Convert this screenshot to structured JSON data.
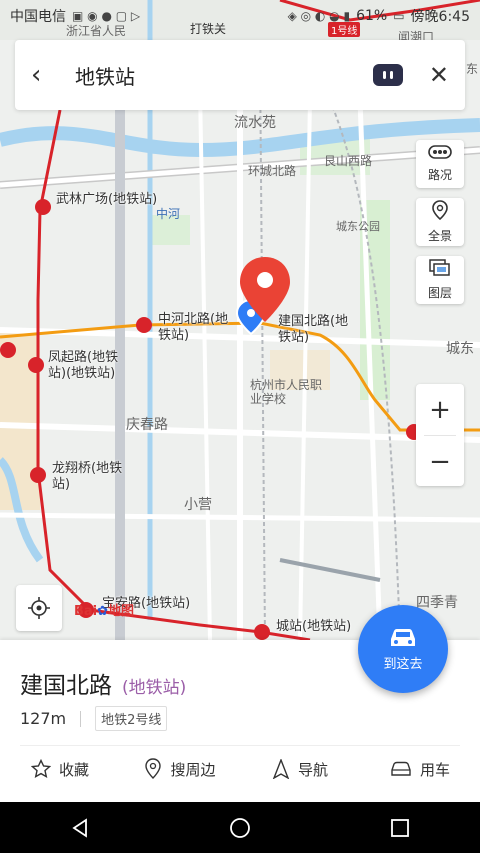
{
  "status_bar": {
    "carrier": "中国电信",
    "battery": "61%",
    "time": "傍晚6:45"
  },
  "search": {
    "query": "地铁站"
  },
  "side_buttons": {
    "traffic": "路况",
    "panorama": "全景",
    "layers": "图层"
  },
  "zoom": {
    "plus": "+",
    "minus": "−"
  },
  "map_labels": {
    "stations": [
      "武林广场(地铁站)",
      "中河北路(地铁站)",
      "建国北路(地铁站)",
      "凤起路(地铁站)(地铁站)",
      "龙翔桥(地铁站)",
      "宝安路(地铁站)",
      "城站(地铁站)"
    ],
    "places": [
      "流水苑",
      "艮山西路",
      "环城北路",
      "城东公园",
      "杭州市人民职业学校",
      "庆春路",
      "小营",
      "四季青",
      "城东",
      "打铁关",
      "1号线",
      "浙江省人民",
      "闻潮口",
      "东"
    ],
    "water": [
      "中河"
    ]
  },
  "logo": {
    "bai": "Bai",
    "du": "地图"
  },
  "goto_button": "到这去",
  "place": {
    "name": "建国北路",
    "type": "(地铁站)",
    "distance": "127m",
    "line": "地铁2号线"
  },
  "actions": [
    {
      "icon": "star-icon",
      "label": "收藏"
    },
    {
      "icon": "pin-icon",
      "label": "搜周边"
    },
    {
      "icon": "navigate-icon",
      "label": "导航"
    },
    {
      "icon": "car-icon",
      "label": "用车"
    }
  ],
  "colors": {
    "route_red": "#d8232a",
    "route_orange": "#f39c12",
    "water": "#a7d3f0",
    "accent_blue": "#2f7df6",
    "pin_red": "#ea4335"
  }
}
